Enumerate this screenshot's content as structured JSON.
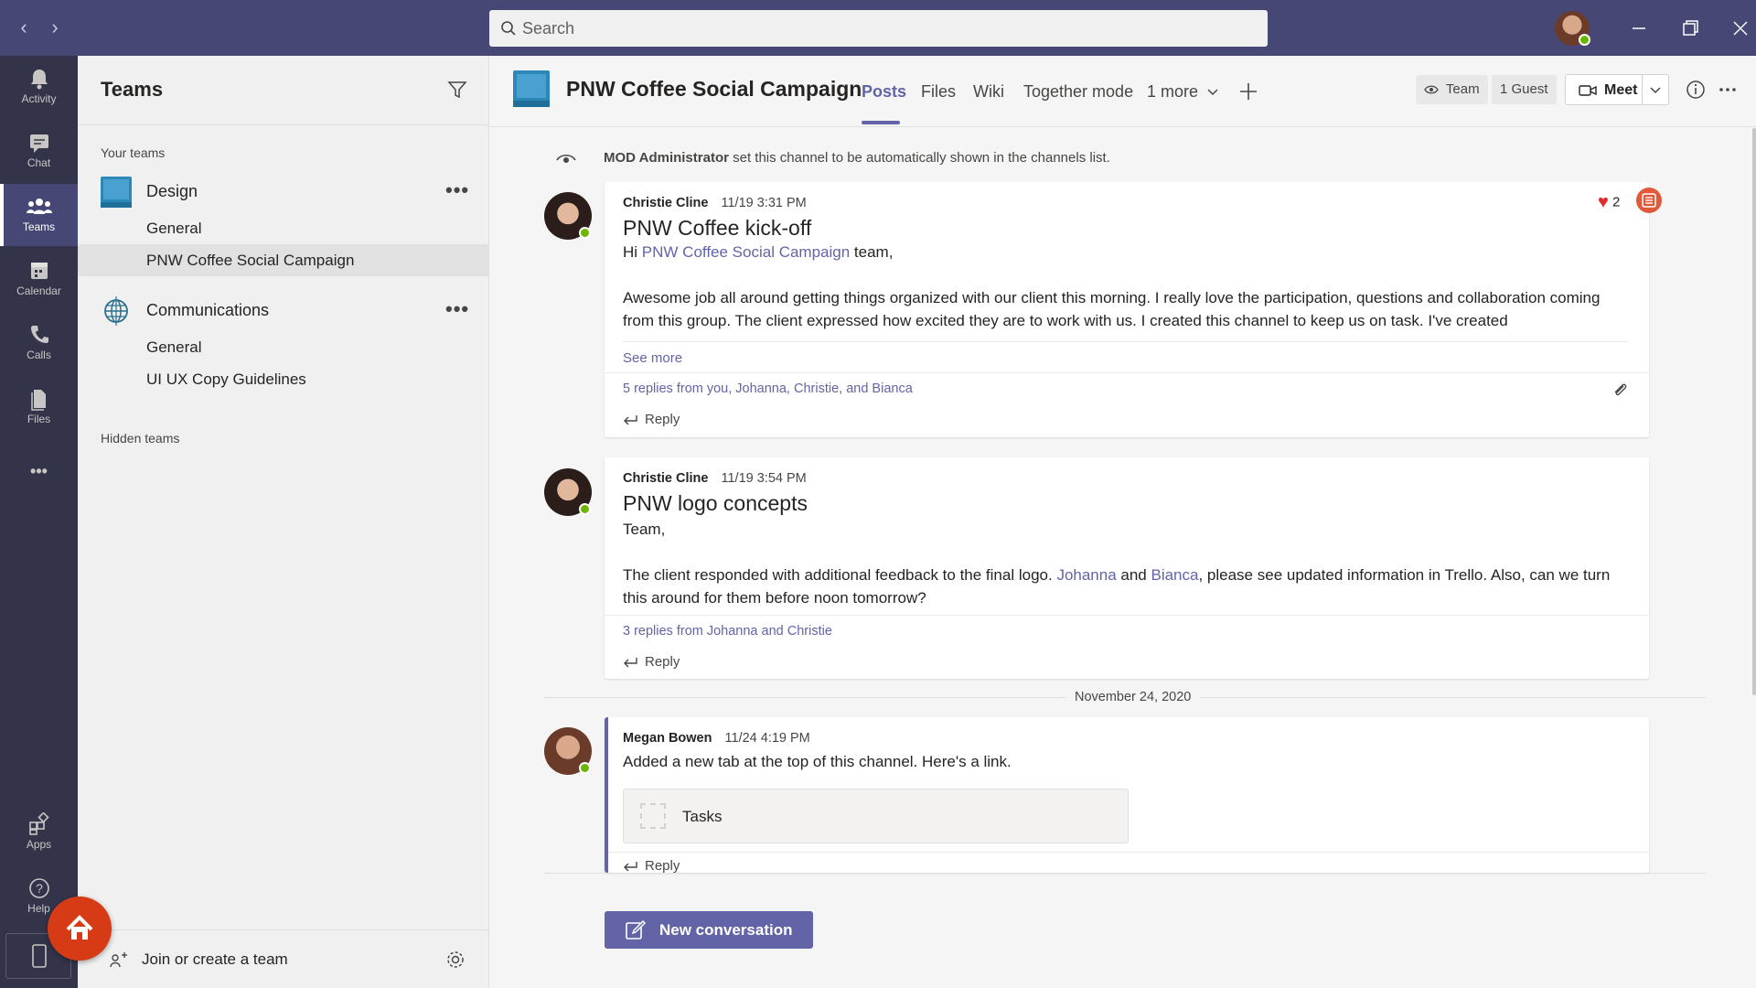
{
  "search": {
    "placeholder": "Search"
  },
  "rail": {
    "items": [
      {
        "label": "Activity",
        "icon": "bell-icon"
      },
      {
        "label": "Chat",
        "icon": "chat-icon"
      },
      {
        "label": "Teams",
        "icon": "teams-icon",
        "active": true
      },
      {
        "label": "Calendar",
        "icon": "calendar-icon"
      },
      {
        "label": "Calls",
        "icon": "phone-icon"
      },
      {
        "label": "Files",
        "icon": "files-icon"
      }
    ],
    "more_label": "•••",
    "bottom": [
      {
        "label": "Apps",
        "icon": "apps-icon"
      },
      {
        "label": "Help",
        "icon": "help-icon"
      }
    ]
  },
  "panel": {
    "title": "Teams",
    "your_teams_label": "Your teams",
    "teams": [
      {
        "name": "Design",
        "channels": [
          "General",
          "PNW Coffee Social Campaign"
        ]
      },
      {
        "name": "Communications",
        "channels": [
          "General",
          "UI UX Copy Guidelines"
        ]
      }
    ],
    "hidden_teams_label": "Hidden teams",
    "join_label": "Join or create a team"
  },
  "channel": {
    "title": "PNW Coffee Social Campaign",
    "tabs": [
      "Posts",
      "Files",
      "Wiki",
      "Together mode",
      "1 more"
    ],
    "team_chip": "Team",
    "guest_chip": "1 Guest",
    "meet_label": "Meet"
  },
  "feed": {
    "system": {
      "actor": "MOD Administrator",
      "text": "set this channel to be automatically shown in the channels list."
    },
    "posts": [
      {
        "author": "Christie Cline",
        "time": "11/19 3:31 PM",
        "title": "PNW Coffee kick-off",
        "greeting_pre": "Hi ",
        "greeting_link": "PNW Coffee Social Campaign",
        "greeting_post": " team,",
        "body": "Awesome job all around getting things organized with our client this morning. I really love the participation, questions and collaboration coming from this group. The client expressed how excited they are to work with us. I created this channel to keep us on task. I've created",
        "see_more": "See more",
        "replies": "5 replies from you, Johanna, Christie, and Bianca",
        "reply_label": "Reply",
        "reaction_count": "2"
      },
      {
        "author": "Christie Cline",
        "time": "11/19 3:54 PM",
        "title": "PNW logo concepts",
        "greeting": "Team,",
        "body_pre": "The client responded with additional feedback to the final logo. ",
        "mention1": "Johanna",
        "body_mid": " and ",
        "mention2": "Bianca",
        "body_post": ", please see updated information in Trello. Also, can we turn this around for them before noon tomorrow?",
        "replies": "3 replies from Johanna and Christie",
        "reply_label": "Reply"
      }
    ],
    "date_separator": "November 24, 2020",
    "post3": {
      "author": "Megan Bowen",
      "time": "11/24 4:19 PM",
      "text": "Added a new tab at the top of this channel. Here's a link.",
      "card_label": "Tasks",
      "reply_label": "Reply"
    },
    "new_conversation_label": "New conversation"
  },
  "colors": {
    "brand": "#6264a7",
    "titlebar": "#464775",
    "rail": "#33344a",
    "accent_red": "#d73b16"
  }
}
